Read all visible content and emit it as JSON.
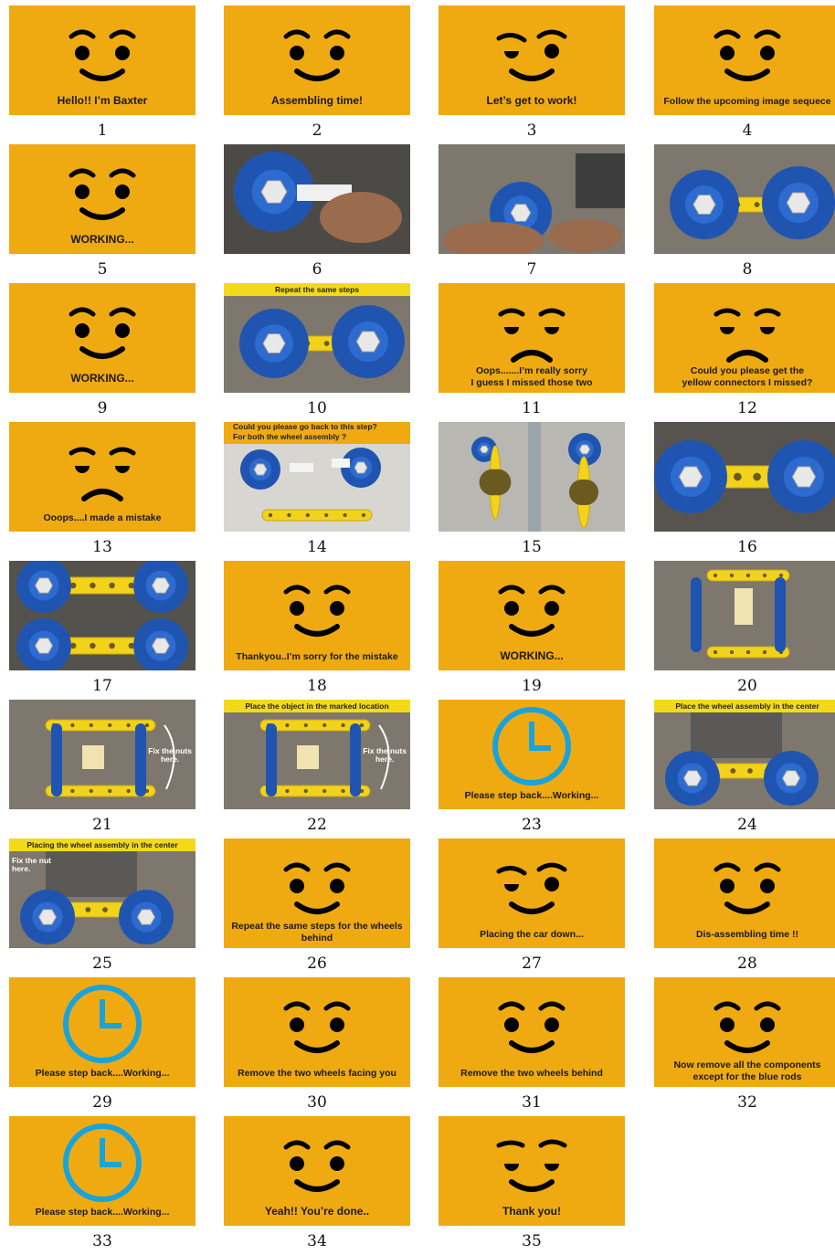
{
  "colors": {
    "panel_yellow": "#efaa12",
    "banner_yellow": "#f2da1a",
    "clock_blue": "#19a3dc",
    "wheel_blue": "#1f55b0"
  },
  "frames": [
    {
      "n": "1",
      "kind": "face",
      "expr": "happy",
      "caption": "Hello!! I’m Baxter"
    },
    {
      "n": "2",
      "kind": "face",
      "expr": "happy",
      "caption": "Assembling time!"
    },
    {
      "n": "3",
      "kind": "face",
      "expr": "determined",
      "caption": "Let’s get to work!"
    },
    {
      "n": "4",
      "kind": "face",
      "expr": "happy",
      "caption": "Follow the upcoming image sequece"
    },
    {
      "n": "5",
      "kind": "face",
      "expr": "happy",
      "caption": "WORKING..."
    },
    {
      "n": "6",
      "kind": "photo",
      "scene": "hand-bolt-wheel",
      "caption": ""
    },
    {
      "n": "7",
      "kind": "photo",
      "scene": "hand-wheel-robot",
      "caption": ""
    },
    {
      "n": "8",
      "kind": "photo",
      "scene": "two-wheels-bar",
      "caption": ""
    },
    {
      "n": "9",
      "kind": "face",
      "expr": "happy",
      "caption": "WORKING..."
    },
    {
      "n": "10",
      "kind": "photo",
      "scene": "two-wheels-bar",
      "banner": "Repeat the same steps",
      "caption": ""
    },
    {
      "n": "11",
      "kind": "face",
      "expr": "sad",
      "caption": "Oops.......I’m really sorry\nI guess I missed those two"
    },
    {
      "n": "12",
      "kind": "face",
      "expr": "sad",
      "caption": "Could you please get the\nyellow connectors I missed?"
    },
    {
      "n": "13",
      "kind": "face",
      "expr": "sad",
      "caption": "Ooops....I made a mistake"
    },
    {
      "n": "14",
      "kind": "photo",
      "scene": "parts-laid-out",
      "banner": "Could you please go back to this step?\nFor both the wheel assembly ?",
      "caption": ""
    },
    {
      "n": "15",
      "kind": "photo",
      "scene": "wheel-on-bar",
      "caption": ""
    },
    {
      "n": "16",
      "kind": "photo",
      "scene": "axle-pair",
      "caption": ""
    },
    {
      "n": "17",
      "kind": "photo",
      "scene": "two-axles",
      "caption": ""
    },
    {
      "n": "18",
      "kind": "face",
      "expr": "happy",
      "caption": "Thankyou..I’m sorry for the mistake"
    },
    {
      "n": "19",
      "kind": "face",
      "expr": "happy",
      "caption": "WORKING..."
    },
    {
      "n": "20",
      "kind": "photo",
      "scene": "chassis-top",
      "caption": ""
    },
    {
      "n": "21",
      "kind": "photo",
      "scene": "chassis-nuts",
      "overlay": "Fix the nuts\nhere.",
      "caption": ""
    },
    {
      "n": "22",
      "kind": "photo",
      "scene": "chassis-nuts",
      "banner": "Place the object in the marked location",
      "overlay": "Fix the nuts\nhere.",
      "caption": ""
    },
    {
      "n": "23",
      "kind": "clock",
      "caption": "Please step back....Working..."
    },
    {
      "n": "24",
      "kind": "photo",
      "scene": "wheel-center",
      "banner": "Place the wheel assembly in the center",
      "caption": ""
    },
    {
      "n": "25",
      "kind": "photo",
      "scene": "wheel-center",
      "banner": "Placing the wheel assembly in the center",
      "overlay2": "Fix the nut\nhere.",
      "caption": ""
    },
    {
      "n": "26",
      "kind": "face",
      "expr": "happy",
      "caption": "Repeat the same steps for the wheels\nbehind"
    },
    {
      "n": "27",
      "kind": "face",
      "expr": "determined",
      "caption": "Placing the car down..."
    },
    {
      "n": "28",
      "kind": "face",
      "expr": "happy",
      "caption": "Dis-assembling time !!"
    },
    {
      "n": "29",
      "kind": "clock",
      "caption": "Please step back....Working..."
    },
    {
      "n": "30",
      "kind": "face",
      "expr": "happy",
      "caption": "Remove the two wheels facing you"
    },
    {
      "n": "31",
      "kind": "face",
      "expr": "happy",
      "caption": "Remove the two wheels behind"
    },
    {
      "n": "32",
      "kind": "face",
      "expr": "happy",
      "caption": "Now remove all the components\nexcept for the blue rods"
    },
    {
      "n": "33",
      "kind": "clock",
      "caption": "Please step back....Working..."
    },
    {
      "n": "34",
      "kind": "face",
      "expr": "happy",
      "caption": "Yeah!! You’re done.."
    },
    {
      "n": "35",
      "kind": "face",
      "expr": "content",
      "caption": "Thank you!"
    }
  ]
}
